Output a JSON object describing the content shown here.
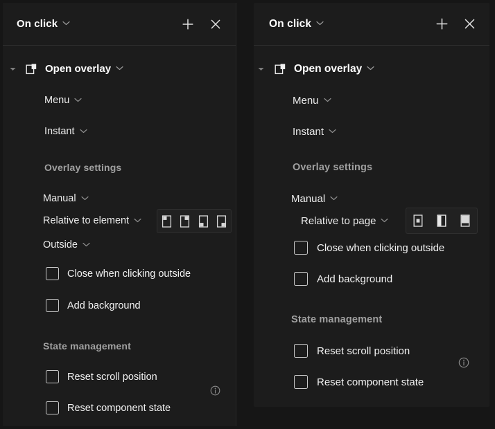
{
  "colors": {
    "app_background": "#161616",
    "panel_background": "#1c1c1c",
    "panel_divider": "#2e2e2e",
    "segmented_background": "#212121",
    "text_primary": "#ffffff",
    "text_secondary": "#eaeaea",
    "section_heading": "#a0a0a0",
    "icon_stroke": "#d8d8d8",
    "checkbox_border": "#c8c8c8"
  },
  "panels": [
    {
      "id": "left",
      "header": {
        "title": "On click",
        "title_caret_icon": "chevron-down-icon",
        "add_icon": "plus-icon",
        "add_label": "+",
        "close_icon": "close-icon",
        "close_label": "×"
      },
      "action": {
        "disclosure_icon": "triangle-down-icon",
        "type_icon": "open-overlay-icon",
        "label": "Open overlay",
        "caret_icon": "chevron-down-icon"
      },
      "fields": [
        {
          "name": "overlay-target",
          "label": "Menu",
          "caret_icon": "chevron-down-icon"
        },
        {
          "name": "animation",
          "label": "Instant",
          "caret_icon": "chevron-down-icon"
        }
      ],
      "sections": [
        {
          "name": "overlay-settings",
          "title": "Overlay settings",
          "info_icon": null,
          "fields": [
            {
              "name": "position-mode",
              "label": "Manual",
              "caret_icon": "chevron-down-icon"
            },
            {
              "name": "position-reference",
              "label": "Relative to element",
              "caret_icon": "chevron-down-icon"
            },
            {
              "name": "placement",
              "label": "Outside",
              "caret_icon": "chevron-down-icon"
            }
          ],
          "segmented": {
            "name": "overlay-position-picker",
            "selected_index": 0,
            "options": [
              {
                "name": "position-top-left-icon",
                "icon": "position-top-left-icon"
              },
              {
                "name": "position-top-right-icon",
                "icon": "position-top-right-icon"
              },
              {
                "name": "position-bottom-left-icon",
                "icon": "position-bottom-left-icon"
              },
              {
                "name": "position-bottom-right-icon",
                "icon": "position-bottom-right-icon"
              }
            ]
          },
          "checkboxes": [
            {
              "name": "close-when-clicking-outside",
              "label": "Close when clicking outside",
              "checked": false
            },
            {
              "name": "add-background",
              "label": "Add background",
              "checked": false
            }
          ]
        },
        {
          "name": "state-management",
          "title": "State management",
          "info_icon": "info-icon",
          "fields": [],
          "checkboxes": [
            {
              "name": "reset-scroll-position",
              "label": "Reset scroll position",
              "checked": false
            },
            {
              "name": "reset-component-state",
              "label": "Reset component state",
              "checked": false
            }
          ]
        }
      ]
    },
    {
      "id": "right",
      "header": {
        "title": "On click",
        "title_caret_icon": "chevron-down-icon",
        "add_icon": "plus-icon",
        "add_label": "+",
        "close_icon": "close-icon",
        "close_label": "×"
      },
      "action": {
        "disclosure_icon": "triangle-down-icon",
        "type_icon": "open-overlay-icon",
        "label": "Open overlay",
        "caret_icon": "chevron-down-icon"
      },
      "fields": [
        {
          "name": "overlay-target",
          "label": "Menu",
          "caret_icon": "chevron-down-icon"
        },
        {
          "name": "animation",
          "label": "Instant",
          "caret_icon": "chevron-down-icon"
        }
      ],
      "sections": [
        {
          "name": "overlay-settings",
          "title": "Overlay settings",
          "info_icon": null,
          "fields": [
            {
              "name": "position-mode",
              "label": "Manual",
              "caret_icon": "chevron-down-icon"
            },
            {
              "name": "position-reference",
              "label": "Relative to page",
              "caret_icon": "chevron-down-icon"
            }
          ],
          "segmented": {
            "name": "overlay-position-picker",
            "selected_index": 1,
            "options": [
              {
                "name": "position-center-icon",
                "icon": "position-center-icon"
              },
              {
                "name": "position-left-half-icon",
                "icon": "position-left-half-icon"
              },
              {
                "name": "position-top-fill-icon",
                "icon": "position-top-fill-icon"
              }
            ]
          },
          "checkboxes": [
            {
              "name": "close-when-clicking-outside",
              "label": "Close when clicking outside",
              "checked": false
            },
            {
              "name": "add-background",
              "label": "Add background",
              "checked": false
            }
          ]
        },
        {
          "name": "state-management",
          "title": "State management",
          "info_icon": "info-icon",
          "fields": [],
          "checkboxes": [
            {
              "name": "reset-scroll-position",
              "label": "Reset scroll position",
              "checked": false
            },
            {
              "name": "reset-component-state",
              "label": "Reset component state",
              "checked": false
            }
          ]
        }
      ]
    }
  ]
}
